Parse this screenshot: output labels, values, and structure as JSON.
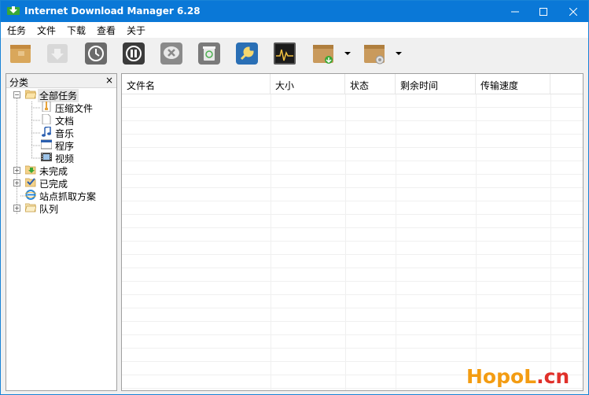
{
  "window": {
    "title": "Internet Download Manager 6.28"
  },
  "menu": [
    {
      "label": "任务"
    },
    {
      "label": "文件"
    },
    {
      "label": "下载"
    },
    {
      "label": "查看"
    },
    {
      "label": "关于"
    }
  ],
  "toolbar": {
    "buttons": [
      {
        "icon": "new-task-icon"
      },
      {
        "icon": "resume-icon"
      },
      {
        "icon": "scheduler-icon"
      },
      {
        "icon": "stop-icon"
      },
      {
        "icon": "delete-icon"
      },
      {
        "icon": "delete-completed-icon"
      },
      {
        "icon": "options-icon"
      },
      {
        "icon": "speed-limiter-icon"
      },
      {
        "icon": "start-queue-icon"
      },
      {
        "icon": "stop-queue-icon"
      }
    ]
  },
  "sidebar": {
    "title": "分类",
    "close": "×",
    "tree": [
      {
        "label": "全部任务",
        "icon": "folder-open-icon"
      },
      {
        "label": "压缩文件",
        "icon": "zip-icon"
      },
      {
        "label": "文档",
        "icon": "document-icon"
      },
      {
        "label": "音乐",
        "icon": "music-icon"
      },
      {
        "label": "程序",
        "icon": "program-icon"
      },
      {
        "label": "视频",
        "icon": "video-icon"
      },
      {
        "label": "未完成",
        "icon": "unfinished-icon"
      },
      {
        "label": "已完成",
        "icon": "finished-icon"
      },
      {
        "label": "站点抓取方案",
        "icon": "grabber-icon"
      },
      {
        "label": "队列",
        "icon": "queue-icon"
      }
    ]
  },
  "list": {
    "columns": [
      {
        "label": "文件名"
      },
      {
        "label": "大小"
      },
      {
        "label": "状态"
      },
      {
        "label": "剩余时间"
      },
      {
        "label": "传输速度"
      }
    ]
  },
  "watermark": {
    "part1": "HopoL",
    "part2": ".cn"
  },
  "colors": {
    "titlebar": "#0a78d7",
    "watermark_orange": "#f39c12",
    "watermark_red": "#e0302a"
  }
}
